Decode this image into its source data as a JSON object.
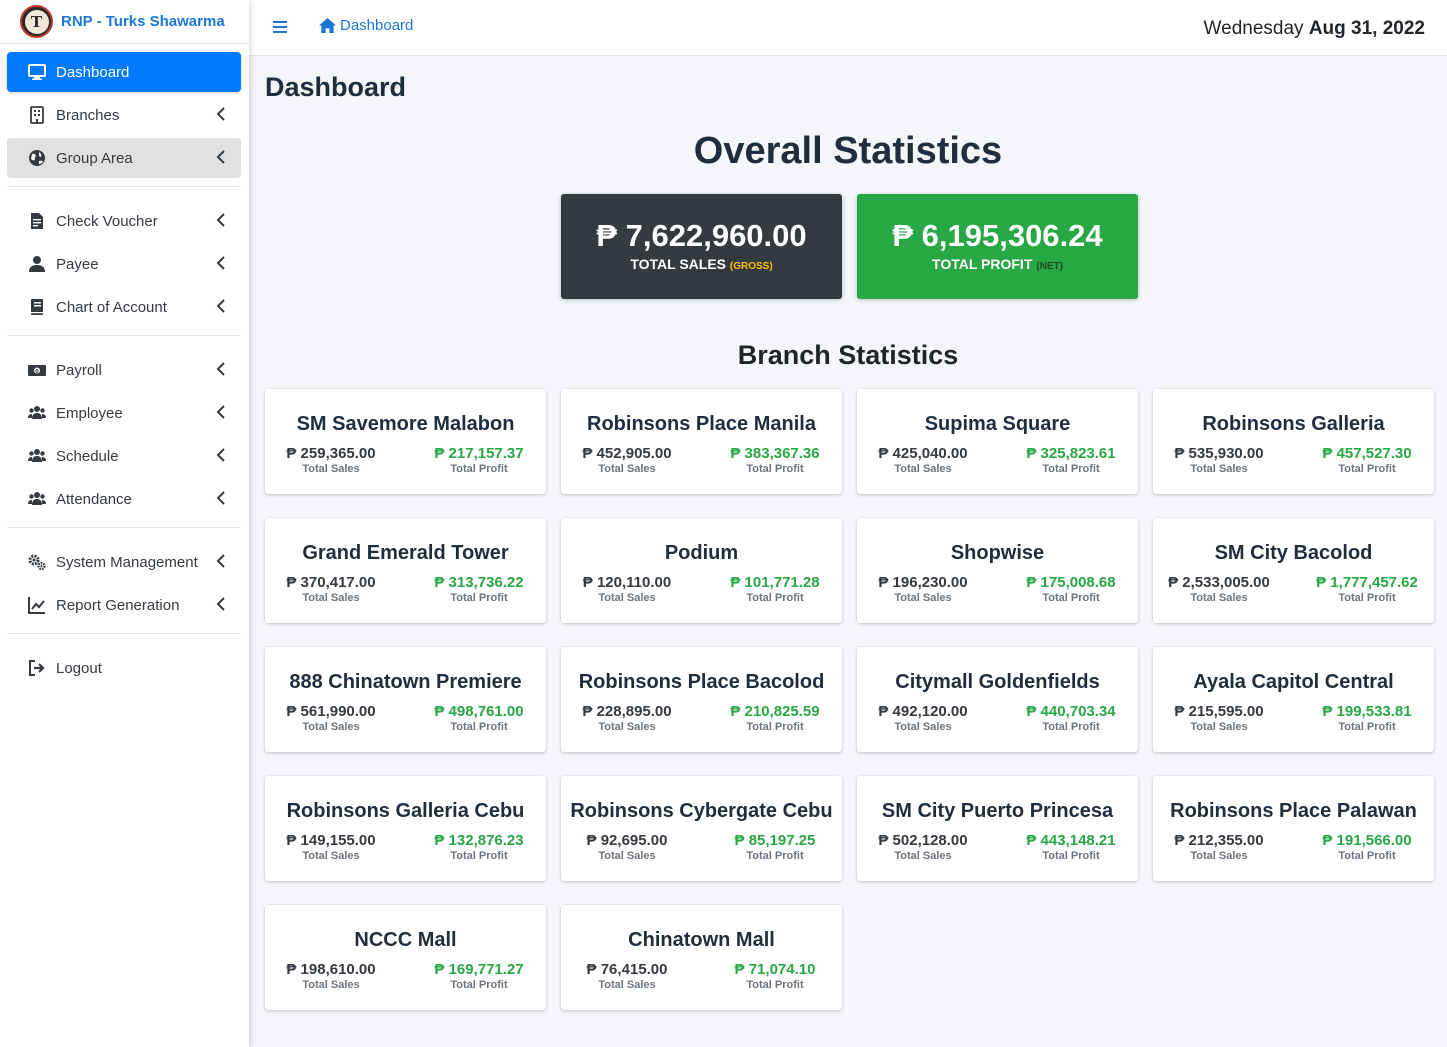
{
  "app": {
    "brand_name": "RNP - Turks Shawarma",
    "logo_letter": "T"
  },
  "sidebar": {
    "groups": [
      [
        {
          "label": "Dashboard",
          "icon": "desktop-icon",
          "active": true,
          "chevron": false
        },
        {
          "label": "Branches",
          "icon": "building-icon",
          "active": false,
          "chevron": true
        },
        {
          "label": "Group Area",
          "icon": "globe-icon",
          "active": false,
          "chevron": true,
          "hover": true
        }
      ],
      [
        {
          "label": "Check Voucher",
          "icon": "file-invoice-icon",
          "active": false,
          "chevron": true
        },
        {
          "label": "Payee",
          "icon": "user-icon",
          "active": false,
          "chevron": true
        },
        {
          "label": "Chart of Account",
          "icon": "book-icon",
          "active": false,
          "chevron": true
        }
      ],
      [
        {
          "label": "Payroll",
          "icon": "money-bill-icon",
          "active": false,
          "chevron": true
        },
        {
          "label": "Employee",
          "icon": "users-icon",
          "active": false,
          "chevron": true
        },
        {
          "label": "Schedule",
          "icon": "users-icon",
          "active": false,
          "chevron": true
        },
        {
          "label": "Attendance",
          "icon": "users-icon",
          "active": false,
          "chevron": true
        }
      ],
      [
        {
          "label": "System Management",
          "icon": "cogs-icon",
          "active": false,
          "chevron": true
        },
        {
          "label": "Report Generation",
          "icon": "chart-line-icon",
          "active": false,
          "chevron": true
        }
      ],
      [
        {
          "label": "Logout",
          "icon": "sign-out-icon",
          "active": false,
          "chevron": false
        }
      ]
    ]
  },
  "topbar": {
    "breadcrumb": "Dashboard",
    "day": "Wednesday",
    "date": "Aug 31, 2022"
  },
  "main": {
    "page_title": "Dashboard",
    "overall_title": "Overall Statistics",
    "total_sales": {
      "value": "₱ 7,622,960.00",
      "label": "TOTAL SALES",
      "qualifier": "(GROSS)"
    },
    "total_profit": {
      "value": "₱ 6,195,306.24",
      "label": "TOTAL PROFIT",
      "qualifier": "(NET)"
    },
    "branch_title": "Branch Statistics",
    "sales_label": "Total Sales",
    "profit_label": "Total Profit",
    "branches": [
      {
        "name": "SM Savemore Malabon",
        "sales": "₱ 259,365.00",
        "profit": "₱ 217,157.37"
      },
      {
        "name": "Robinsons Place Manila",
        "sales": "₱ 452,905.00",
        "profit": "₱ 383,367.36"
      },
      {
        "name": "Supima Square",
        "sales": "₱ 425,040.00",
        "profit": "₱ 325,823.61"
      },
      {
        "name": "Robinsons Galleria",
        "sales": "₱ 535,930.00",
        "profit": "₱ 457,527.30"
      },
      {
        "name": "Grand Emerald Tower",
        "sales": "₱ 370,417.00",
        "profit": "₱ 313,736.22"
      },
      {
        "name": "Podium",
        "sales": "₱ 120,110.00",
        "profit": "₱ 101,771.28"
      },
      {
        "name": "Shopwise",
        "sales": "₱ 196,230.00",
        "profit": "₱ 175,008.68"
      },
      {
        "name": "SM City Bacolod",
        "sales": "₱ 2,533,005.00",
        "profit": "₱ 1,777,457.62"
      },
      {
        "name": "888 Chinatown Premiere",
        "sales": "₱ 561,990.00",
        "profit": "₱ 498,761.00"
      },
      {
        "name": "Robinsons Place Bacolod",
        "sales": "₱ 228,895.00",
        "profit": "₱ 210,825.59"
      },
      {
        "name": "Citymall Goldenfields",
        "sales": "₱ 492,120.00",
        "profit": "₱ 440,703.34"
      },
      {
        "name": "Ayala Capitol Central",
        "sales": "₱ 215,595.00",
        "profit": "₱ 199,533.81"
      },
      {
        "name": "Robinsons Galleria Cebu",
        "sales": "₱ 149,155.00",
        "profit": "₱ 132,876.23"
      },
      {
        "name": "Robinsons Cybergate Cebu",
        "sales": "₱ 92,695.00",
        "profit": "₱ 85,197.25"
      },
      {
        "name": "SM City Puerto Princesa",
        "sales": "₱ 502,128.00",
        "profit": "₱ 443,148.21"
      },
      {
        "name": "Robinsons Place Palawan",
        "sales": "₱ 212,355.00",
        "profit": "₱ 191,566.00"
      },
      {
        "name": "NCCC Mall",
        "sales": "₱ 198,610.00",
        "profit": "₱ 169,771.27"
      },
      {
        "name": "Chinatown Mall",
        "sales": "₱ 76,415.00",
        "profit": "₱ 71,074.10"
      }
    ]
  },
  "colors": {
    "primary": "#007bff",
    "success": "#28a745",
    "dark": "#343a40",
    "warning": "#ffc107"
  }
}
